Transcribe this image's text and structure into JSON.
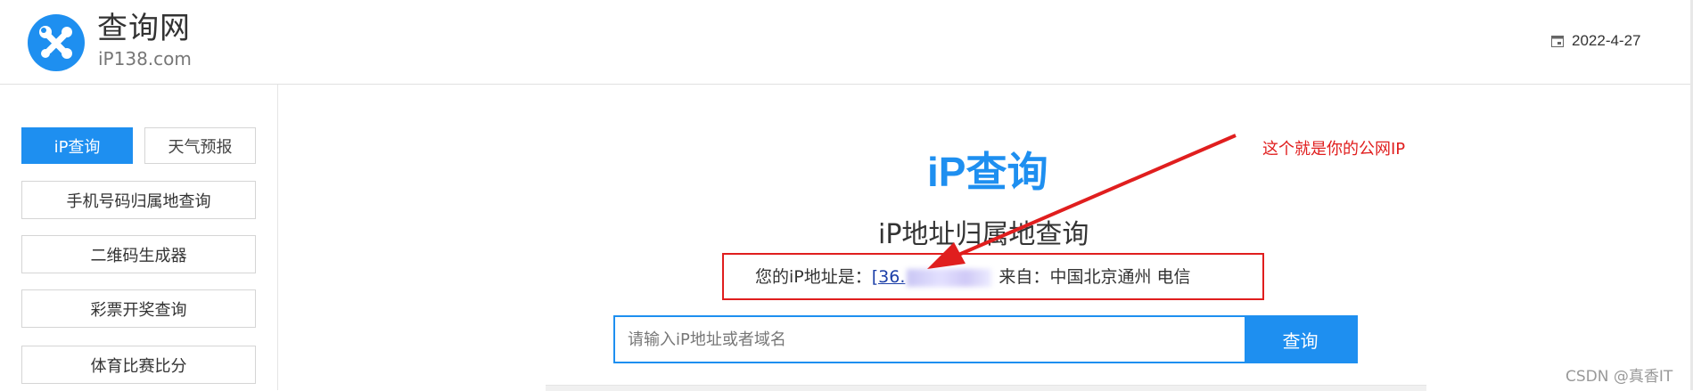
{
  "header": {
    "logo_title": "查询网",
    "logo_subtitle": "iP138.com",
    "date": "2022-4-27"
  },
  "sidebar": {
    "tabs": [
      {
        "label": "iP查询",
        "active": true
      },
      {
        "label": "天气预报",
        "active": false
      }
    ],
    "items": [
      {
        "label": "手机号码归属地查询"
      },
      {
        "label": "二维码生成器"
      },
      {
        "label": "彩票开奖查询"
      },
      {
        "label": "体育比赛比分"
      }
    ]
  },
  "main": {
    "brand_title": "iP查询",
    "subtitle": "iP地址归属地查询",
    "ip_prefix": "您的iP地址是：",
    "ip_value": "[36.",
    "ip_from_label": " 来自：",
    "ip_location": "中国北京通州 电信",
    "search": {
      "placeholder": "请输入iP地址或者域名",
      "button_label": "查询"
    }
  },
  "annotation": {
    "text": "这个就是你的公网IP"
  },
  "watermark": "CSDN @真香IT",
  "colors": {
    "accent": "#1e8ff0",
    "annotation": "#e01e1e"
  }
}
